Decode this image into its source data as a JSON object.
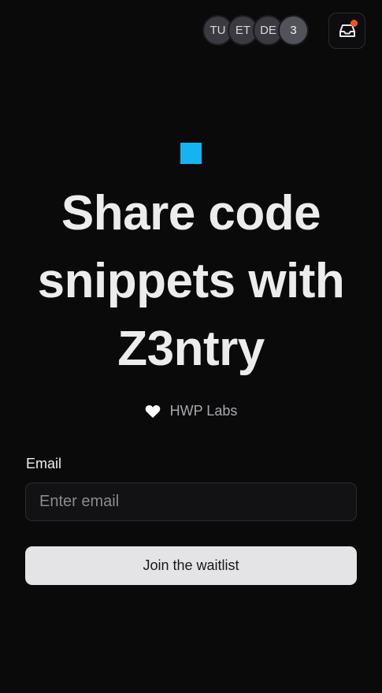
{
  "header": {
    "avatars": [
      {
        "initials": "TU"
      },
      {
        "initials": "ET"
      },
      {
        "initials": "DE"
      }
    ],
    "avatar_overflow_count": "3",
    "inbox": {
      "icon": "inbox-icon",
      "has_notification": true,
      "notification_color": "#f2551f"
    }
  },
  "hero": {
    "logo_color": "#15b4f0",
    "title": "Share code snippets with Z3ntry",
    "credit_icon": "heart-icon",
    "credit_text": "HWP Labs"
  },
  "form": {
    "email_label": "Email",
    "email_placeholder": "Enter email",
    "email_value": "",
    "submit_label": "Join the waitlist"
  },
  "colors": {
    "background": "#0a0a0b",
    "button_bg": "#e4e4e7",
    "accent": "#15b4f0"
  }
}
